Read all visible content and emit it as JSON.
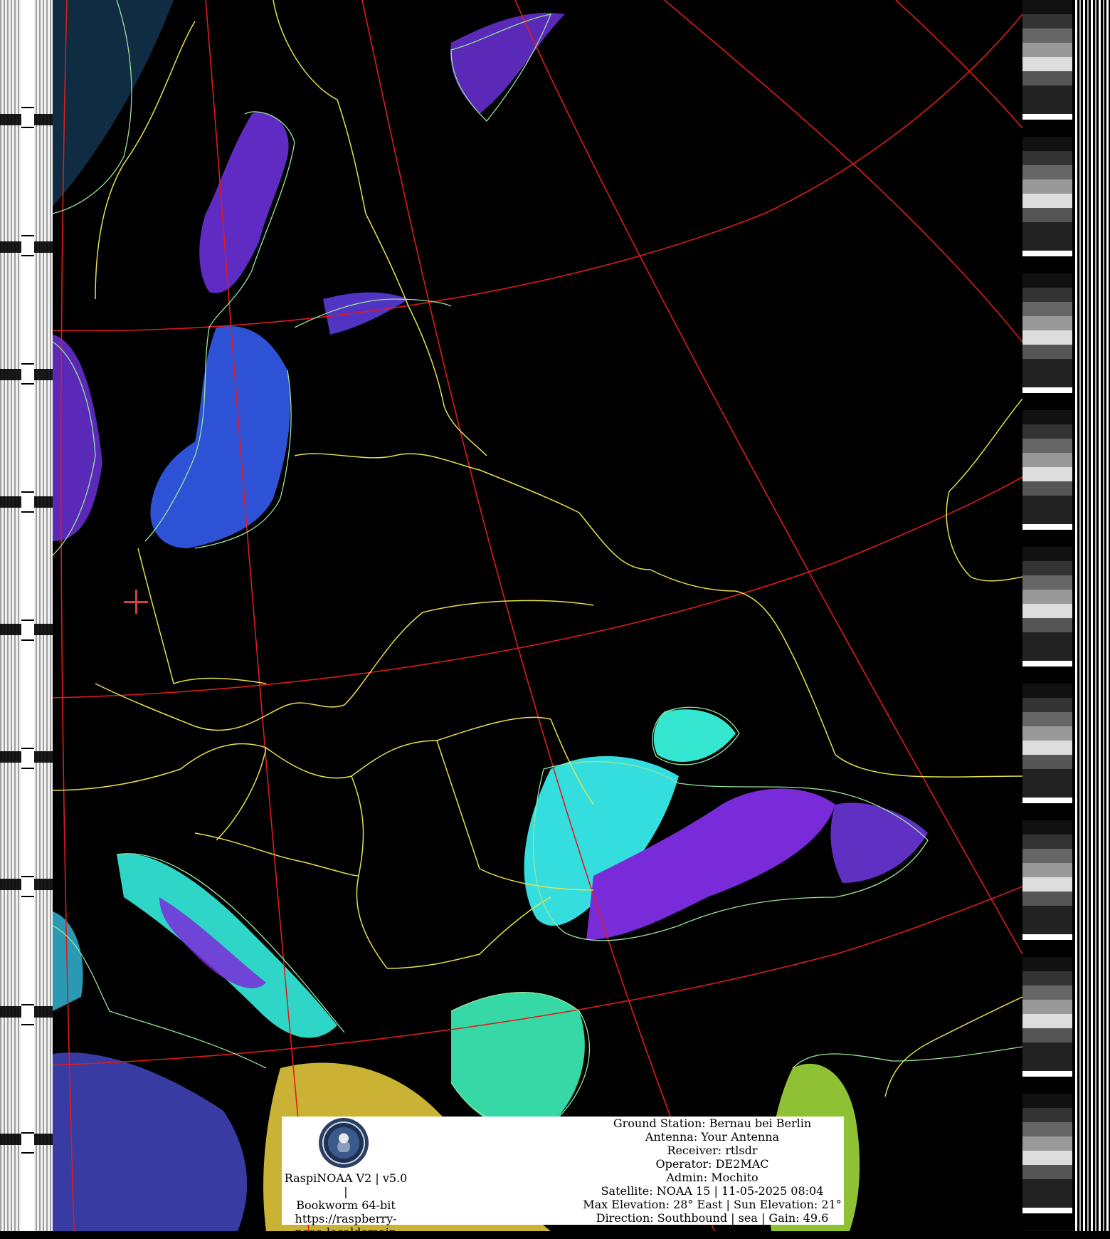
{
  "left_info": {
    "line1": "RaspiNOAA V2 | v5.0 |",
    "line2": "Bookworm 64-bit",
    "line3": "https://raspberry-",
    "line4": "noaa.localdomain"
  },
  "right_info": {
    "ground_station": "Ground Station: Bernau bei Berlin",
    "antenna": "Antenna: Your Antenna",
    "receiver": "Receiver: rtlsdr",
    "operator": "Operator: DE2MAC",
    "admin": "Admin: Mochito",
    "satellite": "Satellite: NOAA 15 | 11-05-2025 08:04",
    "elevation": "Max Elevation: 28° East | Sun Elevation: 21°",
    "direction": "Direction: Southbound | sea | Gain: 49.6"
  },
  "colors": {
    "graticule": "#e01b1b",
    "borders": "#e8e04a",
    "coastline": "#9be39b",
    "cloud_low": "#35e0e0",
    "cloud_high": "#7a2bd9",
    "cloud_mid": "#2f5de0",
    "crosshair": "#d94040"
  },
  "logo_icon": "ground-station-badge"
}
